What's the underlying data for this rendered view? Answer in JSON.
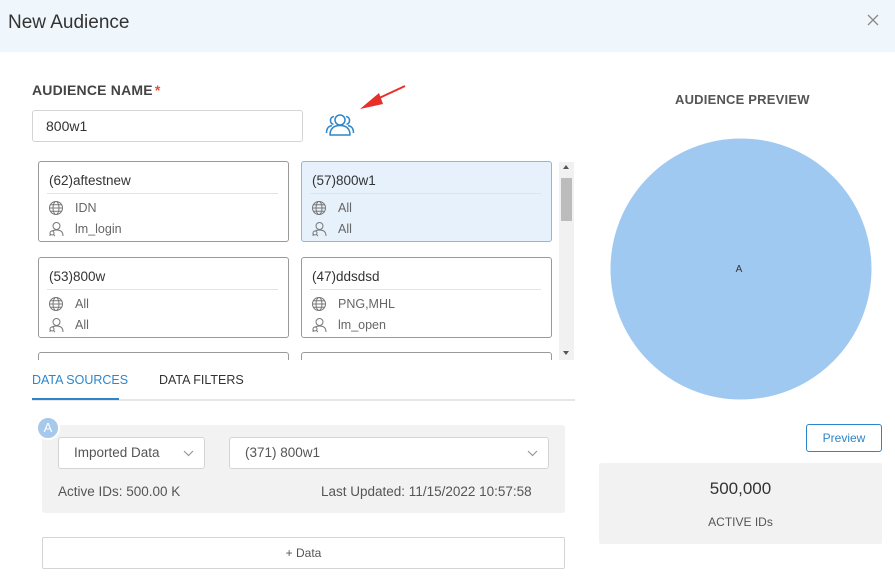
{
  "dialog": {
    "title": "New Audience"
  },
  "audience_name": {
    "label": "AUDIENCE NAME",
    "required_mark": "*",
    "value": "800w1"
  },
  "cards": [
    {
      "title": "(62)aftestnew",
      "region": "IDN",
      "event": "lm_login",
      "selected": false
    },
    {
      "title": "(57)800w1",
      "region": "All",
      "event": "All",
      "selected": true
    },
    {
      "title": "(53)800w",
      "region": "All",
      "event": "All",
      "selected": false
    },
    {
      "title": "(47)ddsdsd",
      "region": "PNG,MHL",
      "event": "lm_open",
      "selected": false
    }
  ],
  "tabs": {
    "sources": "DATA SOURCES",
    "filters": "DATA FILTERS",
    "active": "sources"
  },
  "data_source": {
    "badge": "A",
    "type_select": "Imported Data",
    "dataset_select": "(371) 800w1",
    "active_ids": "Active IDs: 500.00 K",
    "last_updated": "Last Updated: 11/15/2022 10:57:58"
  },
  "add_data_label": "+ Data",
  "preview": {
    "title": "AUDIENCE PREVIEW",
    "set_label": "A",
    "button": "Preview",
    "count": "500,000",
    "count_label": "ACTIVE IDs"
  },
  "colors": {
    "accent": "#2e86c9",
    "venn_fill": "#9fc9f1",
    "arrow": "#e8302a",
    "header_bg": "#f0f7fc"
  }
}
